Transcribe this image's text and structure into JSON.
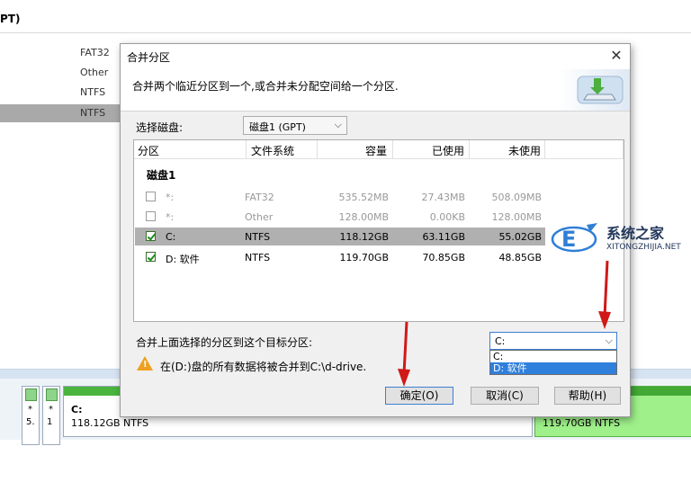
{
  "background": {
    "title": "PT)",
    "fs_list": [
      "FAT32",
      "Other",
      "NTFS",
      "NTFS"
    ],
    "disk_map": {
      "mini1": {
        "star": "*",
        "num": "5."
      },
      "mini2": {
        "star": "*",
        "num": "1"
      },
      "c": {
        "label": "C:",
        "size": "118.12GB NTFS"
      },
      "d": {
        "size": "119.70GB NTFS"
      }
    }
  },
  "dialog": {
    "title": "合并分区",
    "description": "合并两个临近分区到一个,或合并未分配空间给一个分区.",
    "select_disk_label": "选择磁盘:",
    "select_disk_value": "磁盘1 (GPT)",
    "table": {
      "headers": [
        "分区",
        "文件系统",
        "容量",
        "已使用",
        "未使用"
      ],
      "group": "磁盘1",
      "rows": [
        {
          "checked": false,
          "name": "*:",
          "fs": "FAT32",
          "capacity": "535.52MB",
          "used": "27.43MB",
          "free": "508.09MB",
          "disabled": true
        },
        {
          "checked": false,
          "name": "*:",
          "fs": "Other",
          "capacity": "128.00MB",
          "used": "0.00KB",
          "free": "128.00MB",
          "disabled": true
        },
        {
          "checked": true,
          "name": "C:",
          "fs": "NTFS",
          "capacity": "118.12GB",
          "used": "63.11GB",
          "free": "55.02GB",
          "selected": true
        },
        {
          "checked": true,
          "name": "D: 软件",
          "fs": "NTFS",
          "capacity": "119.70GB",
          "used": "70.85GB",
          "free": "48.85GB"
        }
      ]
    },
    "merge_label": "合并上面选择的分区到这个目标分区:",
    "target": {
      "value": "C:",
      "options": [
        "C:",
        "D: 软件"
      ]
    },
    "warning": "在(D:)盘的所有数据将被合并到C:\\d-drive.",
    "buttons": {
      "ok": "确定(O)",
      "cancel": "取消(C)",
      "help": "帮助(H)"
    }
  },
  "watermark": {
    "line1": "系统之家",
    "line2": "XITONGZHIJIA.NET"
  },
  "colors": {
    "selection": "#b0b0b0",
    "highlight": "#2f7fdc",
    "arrow": "#d01818",
    "disk_green": "#49b43e"
  }
}
